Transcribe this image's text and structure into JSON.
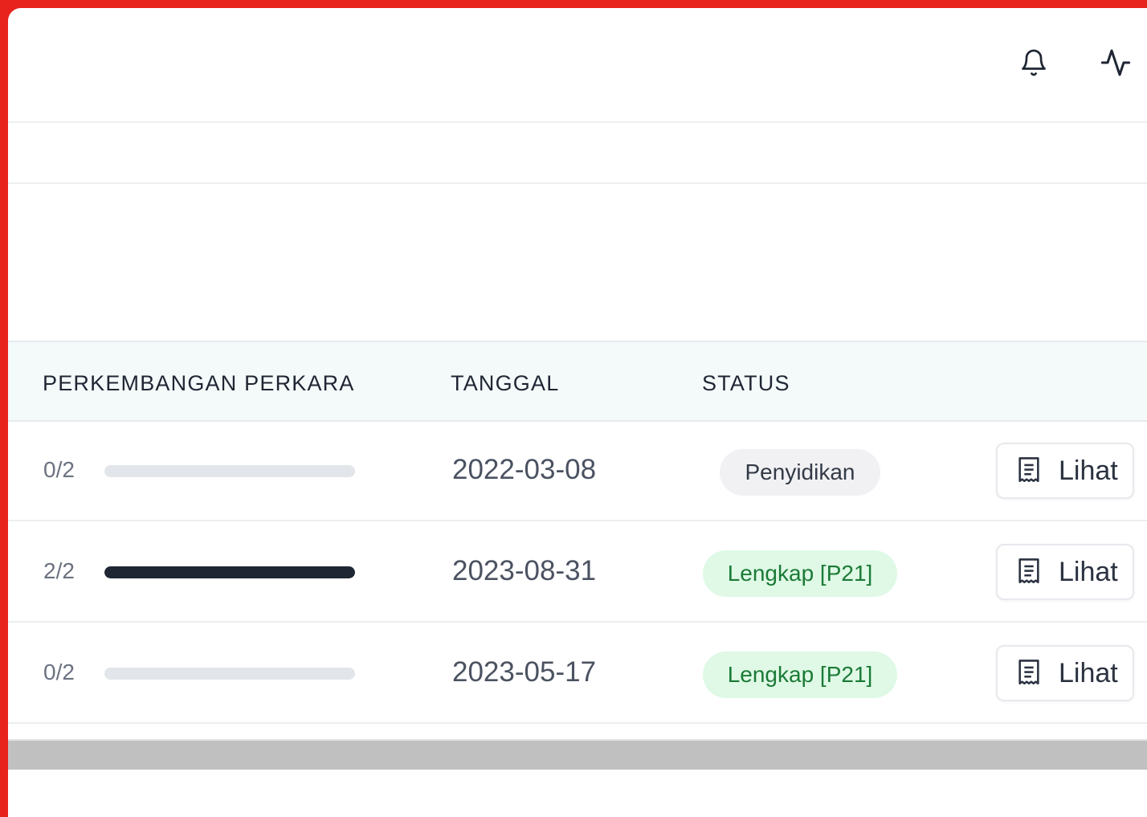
{
  "header": {
    "icons": [
      "bell-icon",
      "activity-icon"
    ]
  },
  "table": {
    "columns": {
      "progress": "PERKEMBANGAN PERKARA",
      "date": "TANGGAL",
      "status": "STATUS"
    },
    "rows": [
      {
        "progress_text": "0/2",
        "progress_value": 0,
        "date": "2022-03-08",
        "status": "Penyidikan",
        "status_color": "#f1f1f4",
        "view_label": "Lihat"
      },
      {
        "progress_text": "2/2",
        "progress_value": 1,
        "date": "2023-08-31",
        "status": "Lengkap [P21]",
        "status_color": "#dff9e6",
        "view_label": "Lihat"
      },
      {
        "progress_text": "0/2",
        "progress_value": 0,
        "date": "2023-05-17",
        "status": "Lengkap [P21]",
        "status_color": "#dff9e6",
        "view_label": "Lihat"
      }
    ]
  },
  "colors": {
    "frame_border": "#e8231d",
    "progress_fill": "#1e2633",
    "progress_track": "#e2e5e9"
  }
}
